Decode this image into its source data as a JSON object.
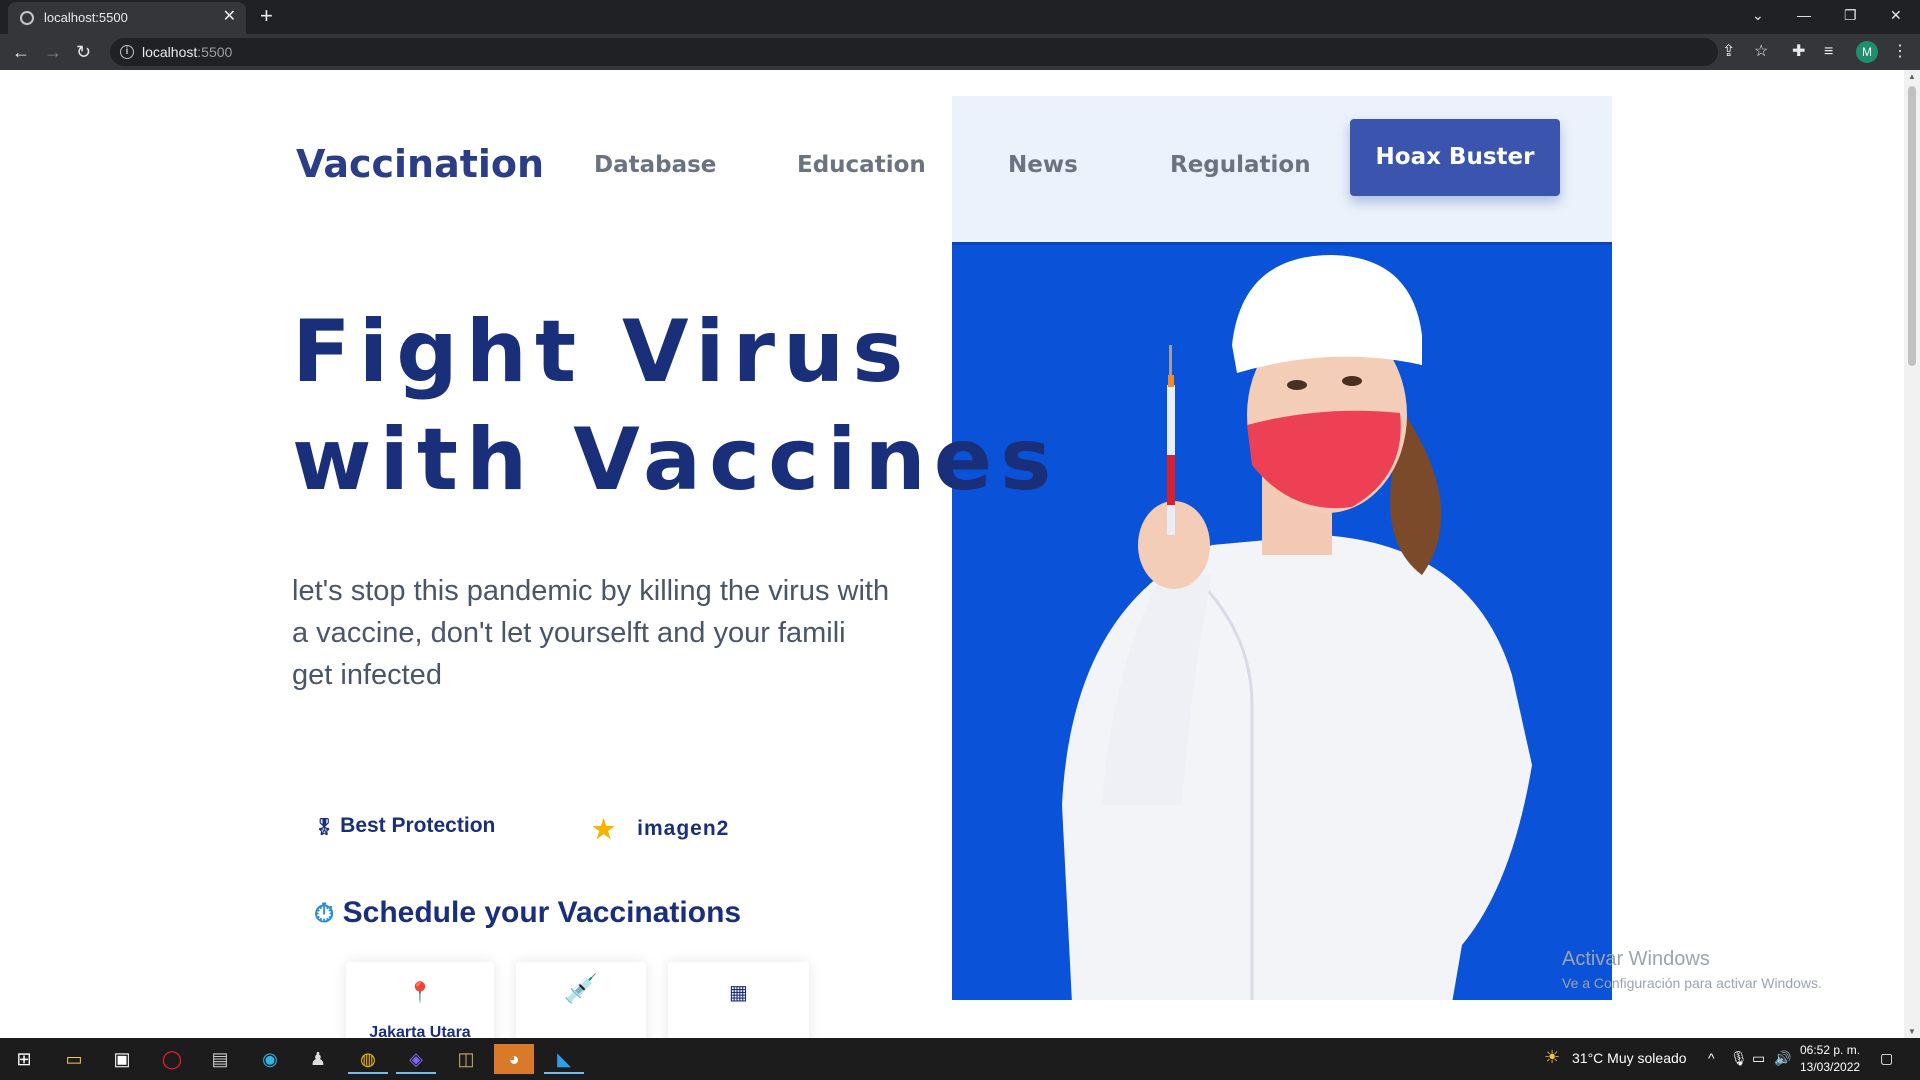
{
  "browser": {
    "tab_title": "localhost:5500",
    "url_host": "localhost",
    "url_port": ":5500",
    "profile_initial": "M"
  },
  "nav": {
    "brand": "Vaccination",
    "links": [
      "Database",
      "Education",
      "News",
      "Regulation"
    ],
    "cta": "Hoax Buster"
  },
  "hero": {
    "headline_line1": "Fight Virus",
    "headline_line2": "with Vaccines",
    "subtext": "let's stop this pandemic by killing the virus with a vaccine, don't let yourselft and your famili get infected"
  },
  "features": {
    "item1": "Best Protection",
    "item2": "imagen2"
  },
  "schedule": {
    "title": "Schedule your Vaccinations",
    "cards": [
      {
        "icon": "location-pin-icon",
        "label": "Jakarta Utara"
      },
      {
        "icon": "syringe-icon",
        "label": ""
      },
      {
        "icon": "calendar-icon",
        "label": ""
      }
    ]
  },
  "watermark": {
    "title": "Activar Windows",
    "subtitle": "Ve a Configuración para activar Windows."
  },
  "taskbar": {
    "weather": "31°C  Muy soleado",
    "time": "06:52 p. m.",
    "date": "13/03/2022"
  },
  "colors": {
    "brand": "#2b3e85",
    "cta": "#3b55ae",
    "hero_bg": "#0a52d8",
    "nav_panel": "#ebf2fb"
  }
}
